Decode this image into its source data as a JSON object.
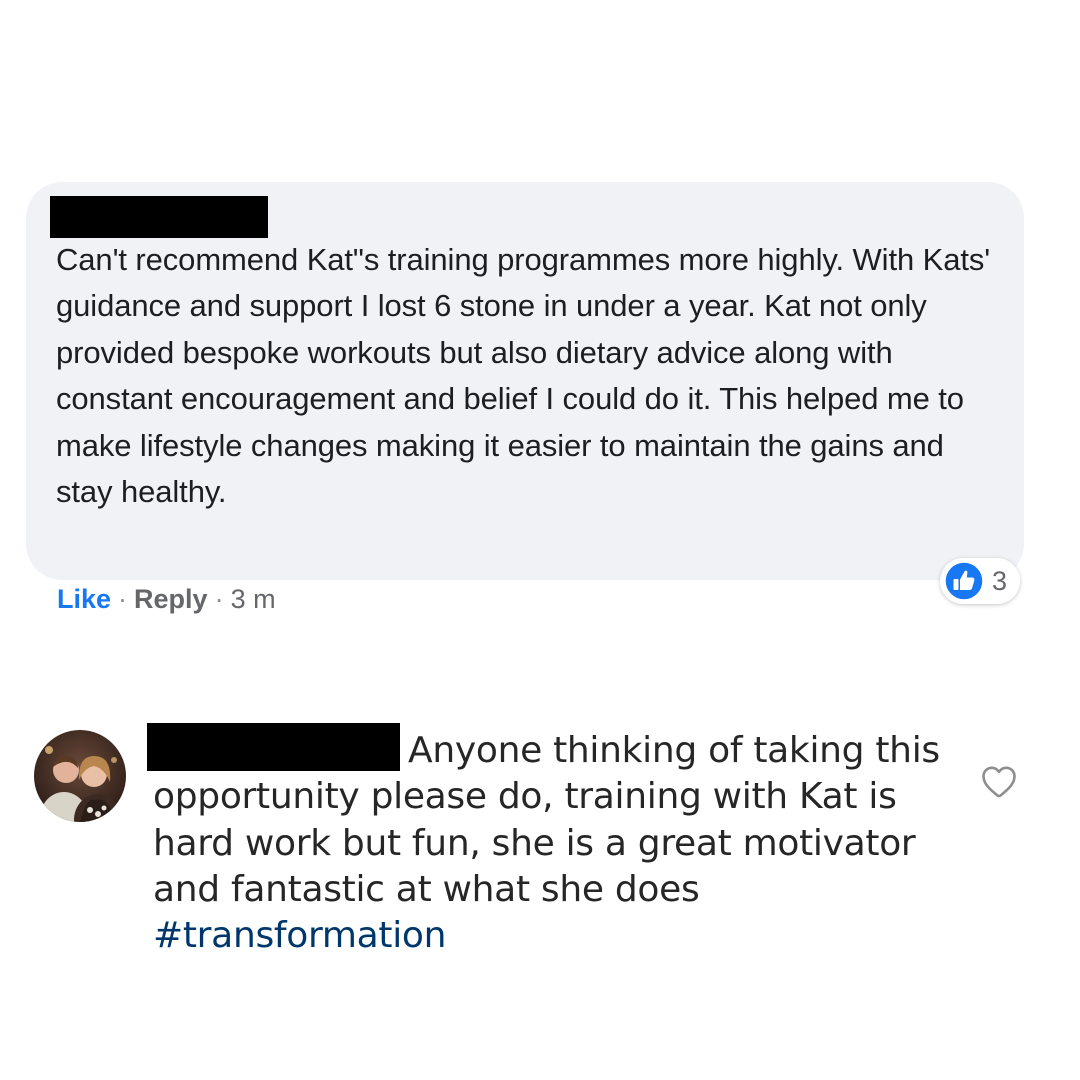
{
  "fb_comment": {
    "text": "Can't recommend Kat\"s training programmes more highly. With Kats' guidance and support I lost 6 stone in under a year. Kat not only provided bespoke workouts but also dietary advice along with constant encouragement and belief I could do it. This helped me to make lifestyle changes making it easier to maintain the gains and stay healthy.",
    "like_label": "Like",
    "separator": "·",
    "reply_label": "Reply",
    "timestamp": "3 m",
    "reaction_count": "3",
    "reaction_icon": "thumbs-up-icon",
    "colors": {
      "bubble": "#f0f2f5",
      "like_blue": "#1877f2",
      "meta_gray": "#65676b"
    }
  },
  "ig_comment": {
    "text": "Anyone thinking of taking this opportunity please do, training with Kat is hard work but fun, she is a great motivator and fantastic at what she does",
    "hashtag": "#transformation",
    "like_icon": "heart-outline-icon",
    "colors": {
      "hashtag": "#00376b",
      "text": "#262626"
    }
  }
}
